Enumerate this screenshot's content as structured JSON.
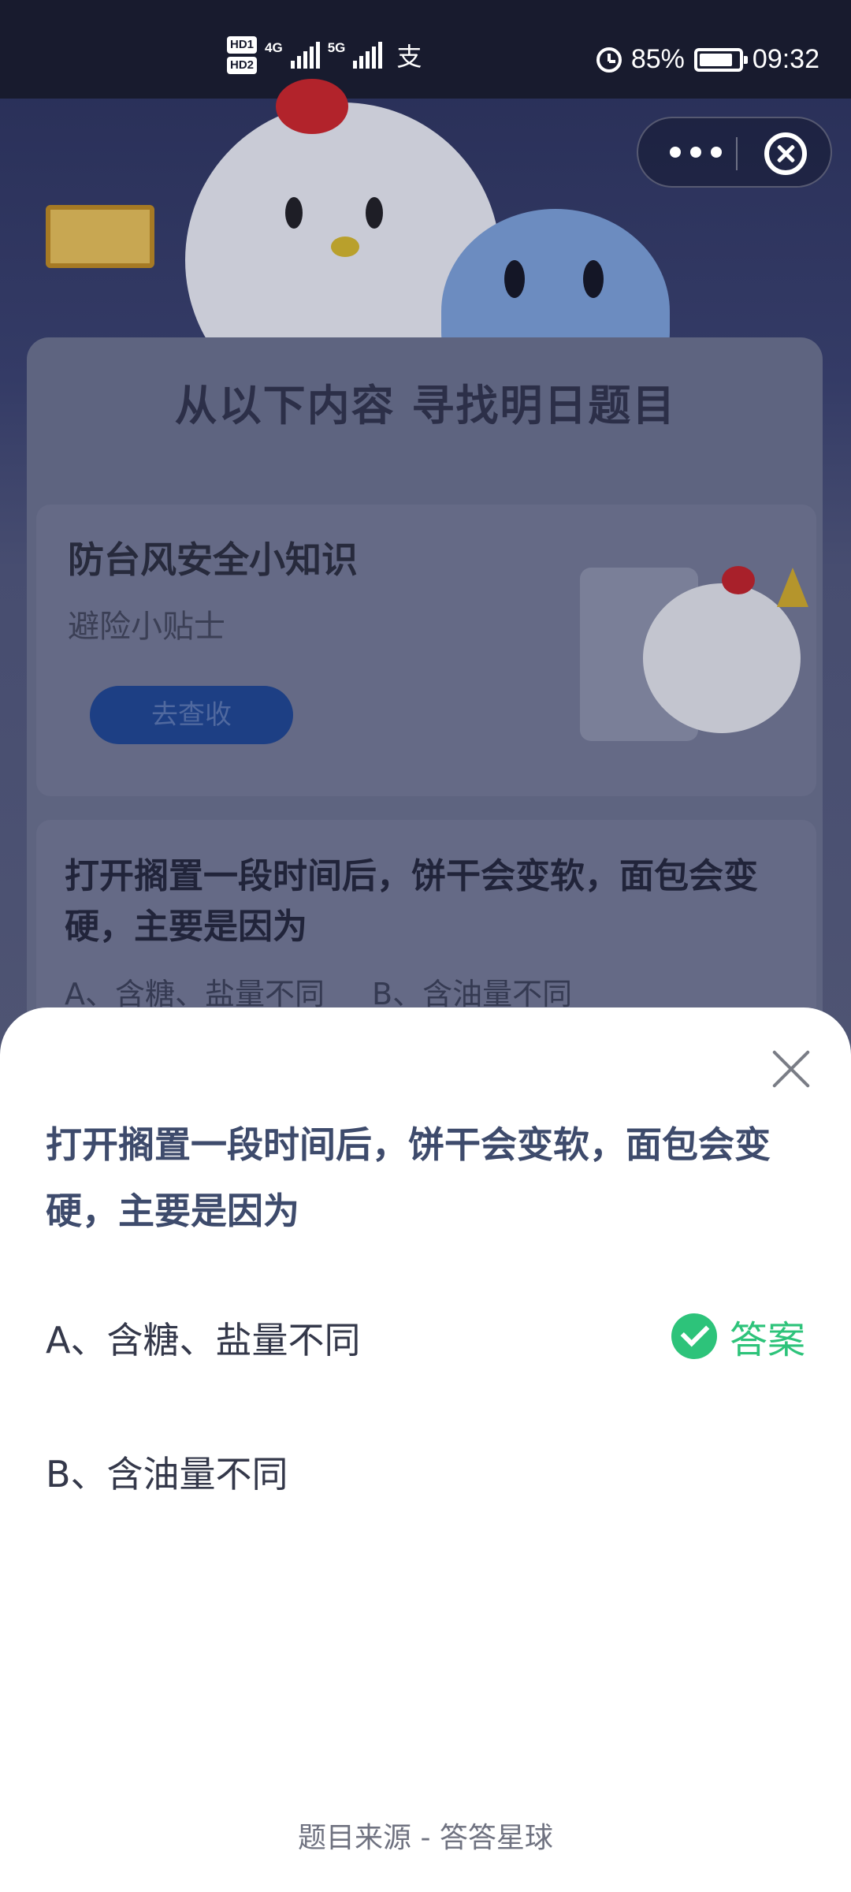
{
  "status_bar": {
    "hd1": "HD1",
    "hd2": "HD2",
    "net1": "4G",
    "net2": "5G",
    "alipay_icon": "支",
    "battery": "85%",
    "time": "09:32"
  },
  "capsule": {
    "more_icon": "more-dots-icon",
    "close_icon": "close-circle-icon"
  },
  "background": {
    "heading": "从以下内容 寻找明日题目",
    "task_card": {
      "title": "防台风安全小知识",
      "subtitle": "避险小贴士",
      "button": "去查收"
    },
    "question_card": {
      "question": "打开搁置一段时间后，饼干会变软，面包会变硬，主要是因为",
      "option_a": "A、含糖、盐量不同",
      "option_b": "B、含油量不同"
    }
  },
  "sheet": {
    "question": "打开搁置一段时间后，饼干会变软，面包会变硬，主要是因为",
    "options": [
      {
        "label": "A、含糖、盐量不同",
        "is_answer": true
      },
      {
        "label": "B、含油量不同",
        "is_answer": false
      }
    ],
    "answer_label": "答案",
    "source": "题目来源 - 答答星球",
    "colors": {
      "answer": "#2dc37a",
      "question": "#3e4b6c"
    }
  }
}
